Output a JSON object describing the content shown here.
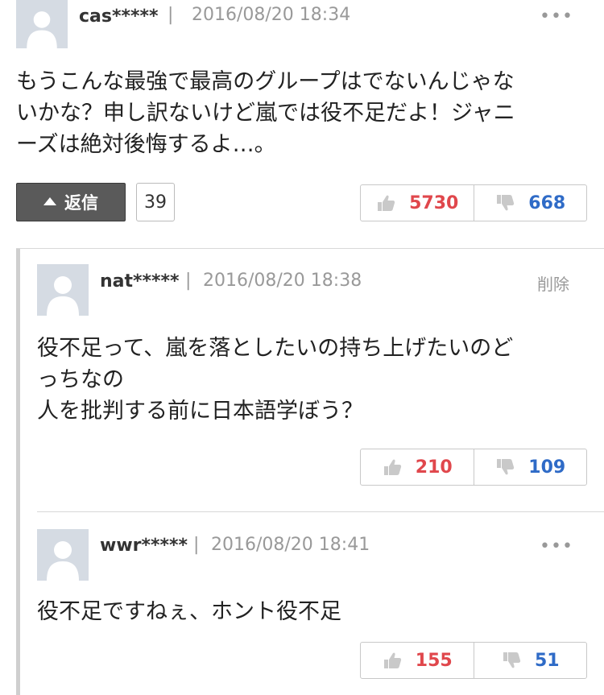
{
  "comment": {
    "user": "cas*****",
    "separator": "|",
    "date": "2016/08/20 18:34",
    "more": "•••",
    "lines": [
      "もうこんな最強で最高のグループはでないんじゃな",
      "いかな？申し訳ないけど嵐では役不足だよ！ジャニ",
      "ーズは絶対後悔するよ…。"
    ],
    "reply_label": "返信",
    "reply_count": "39",
    "likes": "5730",
    "dislikes": "668"
  },
  "replies": [
    {
      "user": "nat*****",
      "separator": "|",
      "date": "2016/08/20 18:38",
      "action": "削除",
      "lines": [
        "役不足って、嵐を落としたいの持ち上げたいのど",
        "っちなの",
        "人を批判する前に日本語学ぼう？"
      ],
      "likes": "210",
      "dislikes": "109"
    },
    {
      "user": "wwr*****",
      "separator": "|",
      "date": "2016/08/20 18:41",
      "action": "•••",
      "lines": [
        "役不足ですねぇ、ホント役不足"
      ],
      "likes": "155",
      "dislikes": "51"
    }
  ],
  "colors": {
    "like": "#e0474c",
    "dislike": "#2f6bc7",
    "reply_button": "#5a5a5a"
  }
}
